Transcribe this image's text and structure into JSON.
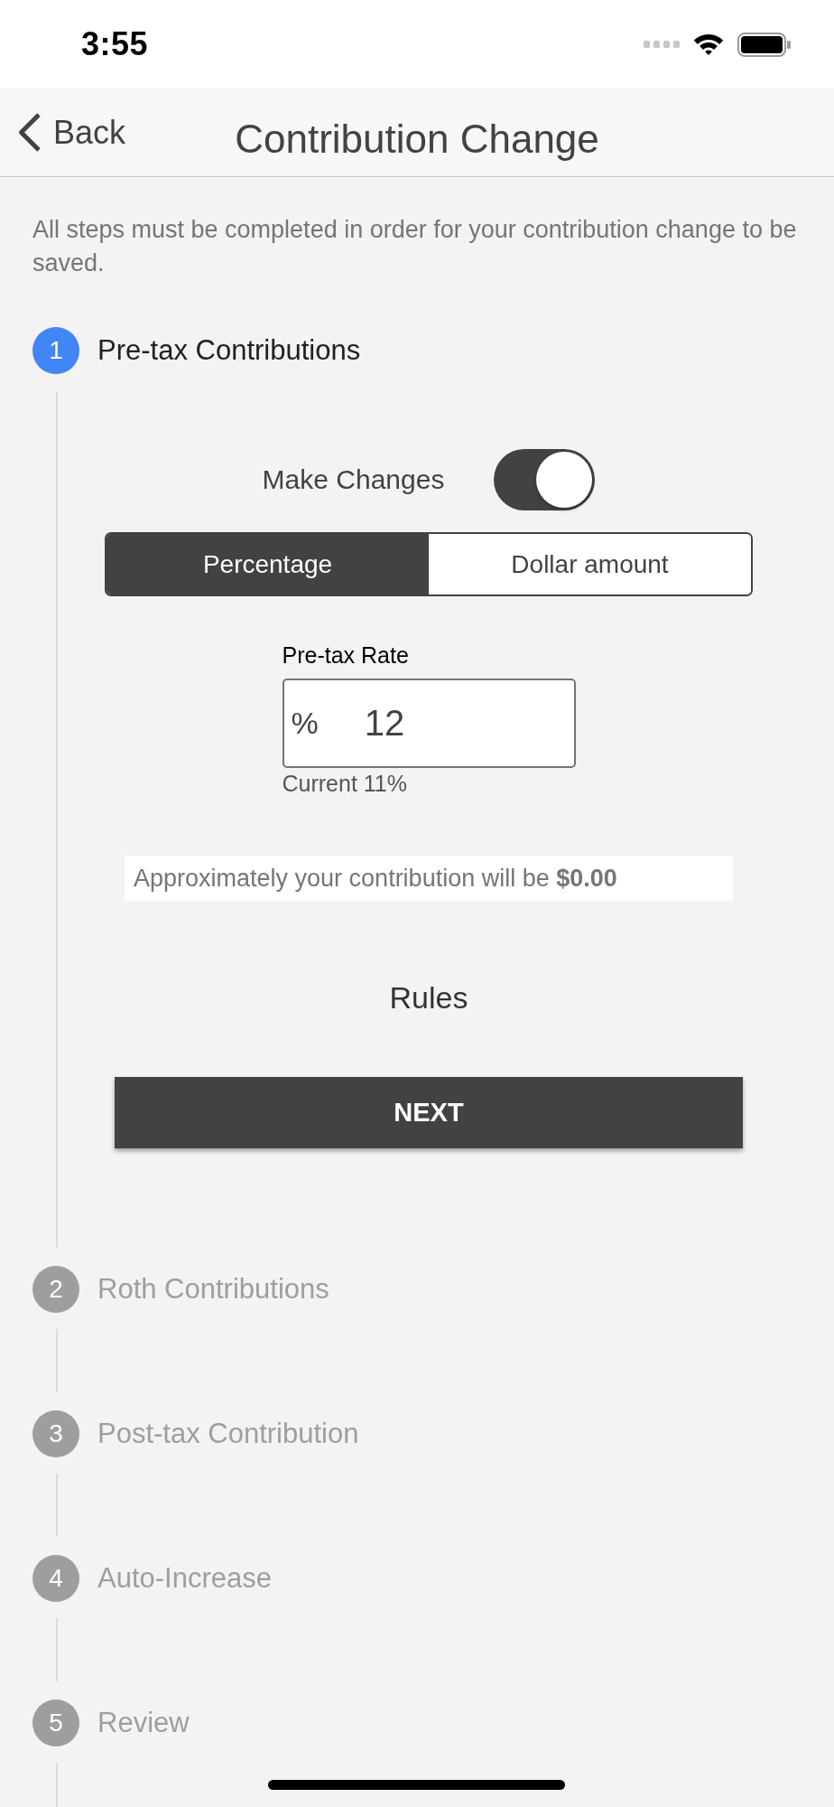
{
  "status_bar": {
    "time": "3:55"
  },
  "nav_bar": {
    "back": "Back",
    "title": "Contribution Change"
  },
  "intro": "All steps must be completed in order for your contribution change to be saved.",
  "steps": [
    {
      "number": "1",
      "label": "Pre-tax Contributions",
      "selected": true,
      "content": {
        "toggle": {
          "label": "Make Changes",
          "on": true
        },
        "segments": [
          {
            "label": "Percentage",
            "selected": true
          },
          {
            "label": "Dollar amount",
            "selected": false
          }
        ],
        "rate_field": {
          "label": "Pre-tax Rate",
          "prefix": "%",
          "value": "12",
          "note": "Current 11%"
        },
        "estimate": "Approximately your contribution will be **$0.00**",
        "rules_link": "Rules",
        "next_button": "NEXT"
      }
    },
    {
      "number": "2",
      "label": "Roth Contributions",
      "selected": false
    },
    {
      "number": "3",
      "label": "Post-tax Contribution",
      "selected": false
    },
    {
      "number": "4",
      "label": "Auto-Increase",
      "selected": false
    },
    {
      "number": "5",
      "label": "Review",
      "selected": false
    }
  ]
}
